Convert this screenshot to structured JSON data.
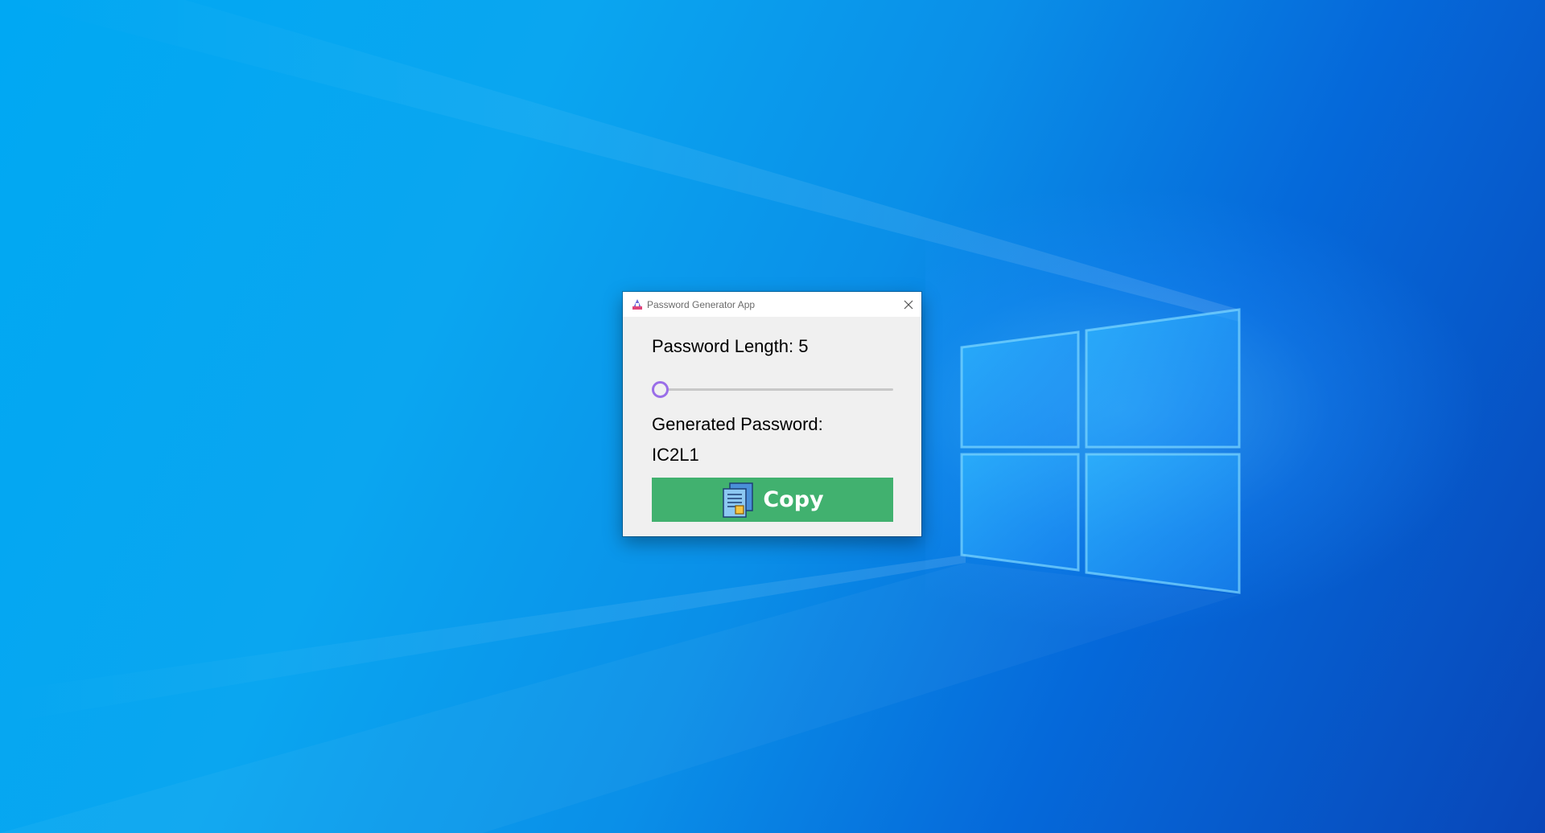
{
  "window": {
    "title": "Password Generator App",
    "icon": "key-app-icon",
    "close_icon": "close-icon"
  },
  "main": {
    "length_label": "Password Length: 5",
    "slider": {
      "value": 5,
      "fill_fraction": 0.0
    },
    "generated_label": "Generated Password:",
    "password_value": "IC2L1",
    "copy_button": {
      "label": "Copy",
      "icon": "document-copy-icon",
      "color": "#41b16f"
    }
  },
  "colors": {
    "slider_thumb": "#9a6ee8",
    "window_bg": "#f0f0f0"
  }
}
